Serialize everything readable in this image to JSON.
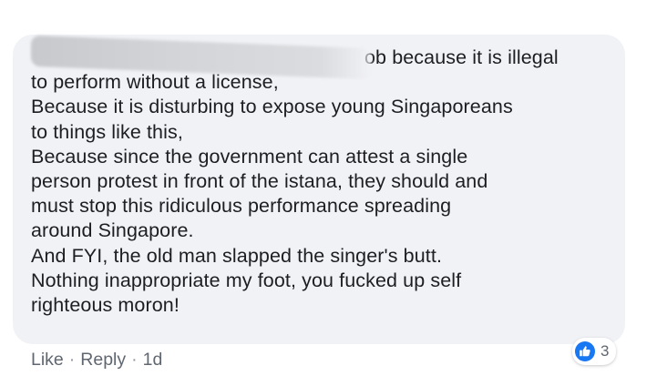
{
  "comment": {
    "author_name_redacted": "",
    "lines": [
      "ob because it is illegal",
      "to perform without a license,",
      "Because it is disturbing to expose young Singaporeans",
      "to things like this,",
      "Because since the government can attest a single",
      "person protest in front of the istana, they should and",
      "must stop this ridiculous performance spreading",
      "around Singapore.",
      "And FYI, the old man slapped the singer's butt.",
      "Nothing inappropriate my foot, you fucked up self",
      "righteous moron!"
    ],
    "bubble_color": "#f1f2f6",
    "text_color": "#1c1e21"
  },
  "actions": {
    "like_label": "Like",
    "reply_label": "Reply",
    "separator": "·",
    "timestamp": "1d"
  },
  "reactions": {
    "icon": "thumbs-up-icon",
    "count": "3",
    "icon_color": "#1877f2"
  }
}
